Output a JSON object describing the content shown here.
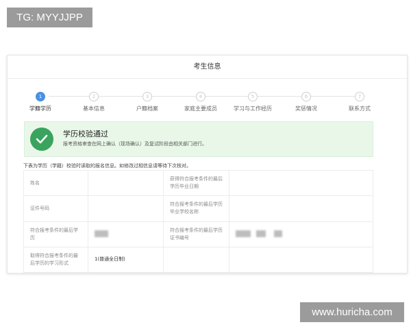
{
  "watermark_top": "TG: MYYJJPP",
  "watermark_bottom": "www.huricha.com",
  "page_title": "考生信息",
  "steps": [
    {
      "num": "1",
      "label": "学籍学历",
      "active": true
    },
    {
      "num": "2",
      "label": "基本信息",
      "active": false
    },
    {
      "num": "3",
      "label": "户籍档案",
      "active": false
    },
    {
      "num": "4",
      "label": "家庭主要成员",
      "active": false
    },
    {
      "num": "5",
      "label": "学习与工作经历",
      "active": false
    },
    {
      "num": "6",
      "label": "奖惩情况",
      "active": false
    },
    {
      "num": "7",
      "label": "联系方式",
      "active": false
    }
  ],
  "banner": {
    "title": "学历校验通过",
    "desc": "报考资格审查在网上确认（现场确认）及复试阶段由相关部门进行。",
    "icon": "check-icon",
    "color": "#3aa35e"
  },
  "intro": "下表为学历（学籍）校验时读取的报名信息。如修改过相信息请等待下次核对。",
  "table": {
    "name_label": "姓名",
    "grad_date_label": "获得符合报考条件的最后学历毕业日期",
    "id_label": "证件号码",
    "school_label": "符合报考条件的最后学历毕业学校名称",
    "degree_label": "符合报考条件的最后学历",
    "cert_label": "符合报考条件的最后学历证书编号",
    "study_form_label": "取得符合报考条件的最后学历的学习形式",
    "study_form_value": "1(普通全日制)"
  }
}
